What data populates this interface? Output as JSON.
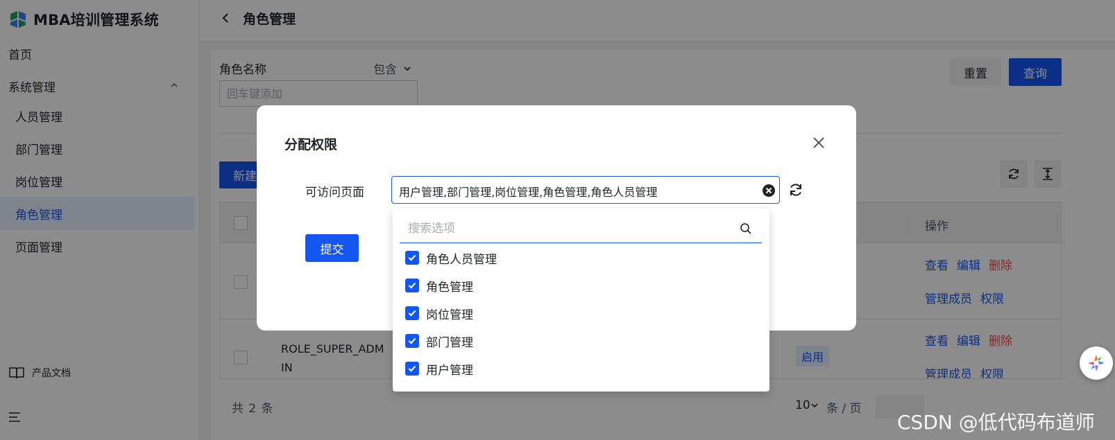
{
  "app": {
    "title": "MBA培训管理系统"
  },
  "sidebar": {
    "items": [
      {
        "label": "首页"
      },
      {
        "label": "系统管理"
      },
      {
        "label": "人员管理"
      },
      {
        "label": "部门管理"
      },
      {
        "label": "岗位管理"
      },
      {
        "label": "角色管理"
      },
      {
        "label": "页面管理"
      }
    ],
    "doc_link": "产品文档"
  },
  "header": {
    "title": "角色管理"
  },
  "filter": {
    "label": "角色名称",
    "operator": "包含",
    "placeholder": "回车键添加",
    "reset_label": "重置",
    "query_label": "查询"
  },
  "toolbar": {
    "new_label": "新建"
  },
  "table": {
    "op_header": "操作",
    "rows": [
      {
        "code": "",
        "actions": [
          "查看",
          "编辑",
          "删除",
          "管理成员",
          "权限"
        ]
      },
      {
        "code": "ROLE_SUPER_ADMIN",
        "status": "启用",
        "actions": [
          "查看",
          "编辑",
          "删除",
          "管理成员",
          "权限"
        ]
      }
    ]
  },
  "pagination": {
    "total_text": "共 2 条",
    "page_size": "10",
    "unit": "条 / 页"
  },
  "dialog": {
    "title": "分配权限",
    "field_label": "可访问页面",
    "selected_value": "用户管理,部门管理,岗位管理,角色管理,角色人员管理",
    "submit_label": "提交"
  },
  "dropdown": {
    "search_placeholder": "搜索选项",
    "options": [
      {
        "label": "角色人员管理",
        "checked": true
      },
      {
        "label": "角色管理",
        "checked": true
      },
      {
        "label": "岗位管理",
        "checked": true
      },
      {
        "label": "部门管理",
        "checked": true
      },
      {
        "label": "用户管理",
        "checked": true
      }
    ]
  },
  "watermark": "CSDN @低代码布道师",
  "colors": {
    "primary": "#1456f0",
    "danger": "#f54a45",
    "overlay": "rgba(0,0,0,0.45)"
  }
}
